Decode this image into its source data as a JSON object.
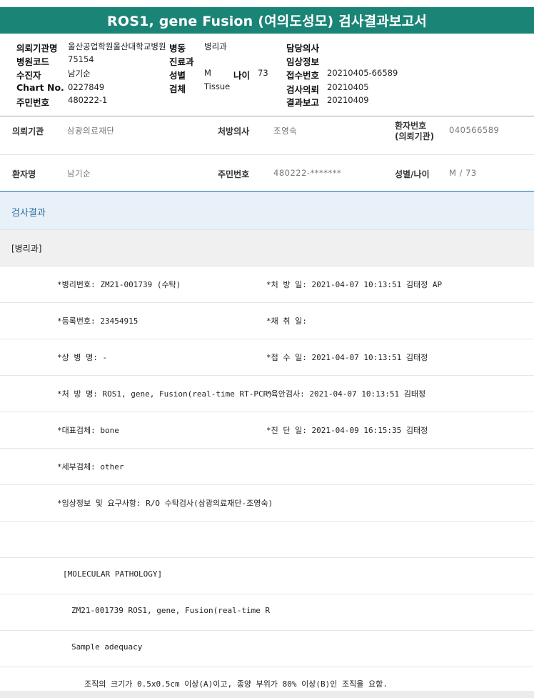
{
  "report": {
    "title": "ROS1, gene Fusion (여의도성모) 검사결과보고서"
  },
  "header": {
    "requesting_institution_label": "의뢰기관명",
    "requesting_institution": "울산공업학원울산대학교병원",
    "ward_label": "병동",
    "ward": "병리과",
    "attending_label": "담당의사",
    "attending": "",
    "hospital_code_label": "병원코드",
    "hospital_code": "75154",
    "department_label": "진료과",
    "department": "",
    "clinical_info_label": "임상정보",
    "clinical_info": "",
    "examinee_label": "수진자",
    "examinee": "남기순",
    "sex_label": "성별",
    "sex": "M",
    "age_label": "나이",
    "age": "73",
    "receipt_no_label": "접수번호",
    "receipt_no": "20210405-66589",
    "chart_no_label": "Chart No.",
    "chart_no": "0227849",
    "specimen_label": "검체",
    "specimen": "Tissue",
    "test_request_label": "검사의뢰",
    "test_request": "20210405",
    "resident_no_label": "주민번호",
    "resident_no": "480222-1",
    "result_report_label": "결과보고",
    "result_report": "20210409"
  },
  "patient_info": {
    "institution_label": "의뢰기관",
    "institution": "삼광의료재단",
    "prescriber_label": "처방의사",
    "prescriber": "조영숙",
    "patient_no_label_1": "환자번호",
    "patient_no_label_2": "(의뢰기관)",
    "patient_no": "040566589",
    "patient_name_label": "환자명",
    "patient_name": "남기순",
    "resident_no_label": "주민번호",
    "resident_no": "480222-*******",
    "sex_age_label": "성별/나이",
    "sex_age": "M / 73"
  },
  "results": {
    "section_title": "검사결과",
    "department_tag": "[병리과]",
    "rows": [
      {
        "left": "*병리번호: ZM21-001739 (수탁)",
        "right": "*처 방 일: 2021-04-07 10:13:51  김태정 AP"
      },
      {
        "left": "*등록번호: 23454915",
        "right": "*채 취 일:"
      },
      {
        "left": "*상 병 명: -",
        "right": "*접 수 일: 2021-04-07 10:13:51  김태정"
      },
      {
        "left": "*처 방 명: ROS1, gene, Fusion(real-time RT-PCR)",
        "right": "*육안검사: 2021-04-07 10:13:51  김태정"
      },
      {
        "left": "*대표검체: bone",
        "right": "*진 단 일: 2021-04-09 16:15:35  김태정"
      },
      {
        "left": "*세부검체: other",
        "right": ""
      },
      {
        "left": "*임상정보 및 요구사항: R/O 수탁검사(삼광의료재단-조영숙)",
        "right": ""
      },
      {
        "left": "",
        "right": ""
      }
    ],
    "molecular_heading": "[MOLECULAR PATHOLOGY]",
    "molecular_line": "ZM21-001739     ROS1, gene, Fusion(real-time R",
    "sample_adequacy": "Sample adequacy",
    "adequacy_note": "조직의 크기가 0.5x0.5cm 이상(A)이고, 종양 부위가 80% 이상(B)인 조직을 요함."
  }
}
